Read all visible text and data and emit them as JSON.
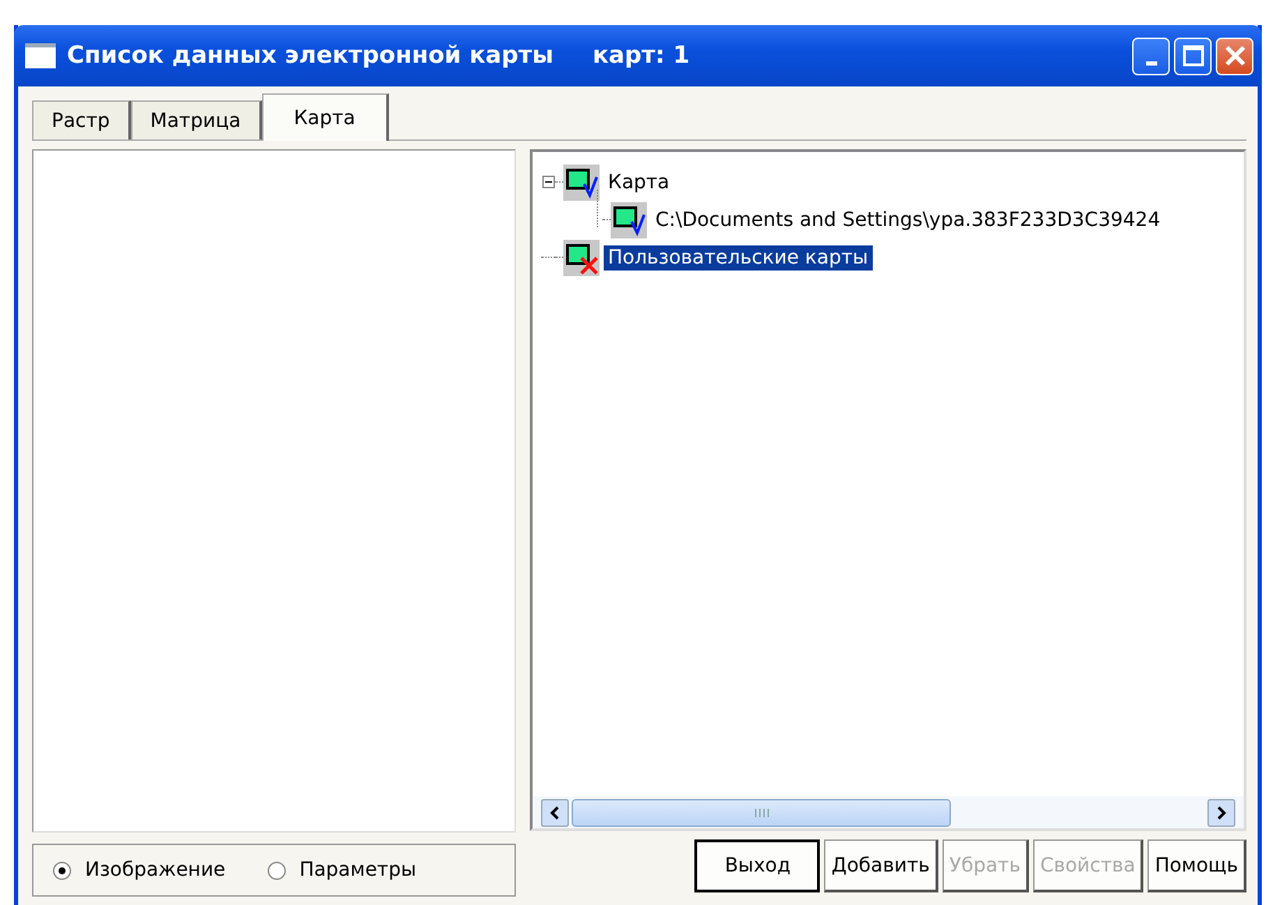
{
  "window": {
    "title": "Список данных электронной карты",
    "count": "карт: 1"
  },
  "tabs": [
    {
      "label": "Растр",
      "selected": false
    },
    {
      "label": "Матрица",
      "selected": false
    },
    {
      "label": "Карта",
      "selected": true
    }
  ],
  "tree": [
    {
      "label": "Карта",
      "kind": "map",
      "selected": false,
      "expanded": true,
      "children": [
        {
          "label": "C:\\Documents and Settings\\ура.383F233D3C39424",
          "kind": "map",
          "selected": false
        }
      ]
    },
    {
      "label": "Пользовательские карты",
      "kind": "user-map",
      "selected": true
    }
  ],
  "view_options": [
    {
      "label": "Изображение",
      "selected": true
    },
    {
      "label": "Параметры",
      "selected": false
    }
  ],
  "buttons": [
    {
      "label": "Выход",
      "disabled": false,
      "default": true
    },
    {
      "label": "Добавить",
      "disabled": false,
      "default": false
    },
    {
      "label": "Убрать",
      "disabled": true,
      "default": false
    },
    {
      "label": "Свойства",
      "disabled": true,
      "default": false
    },
    {
      "label": "Помощь",
      "disabled": false,
      "default": false
    }
  ]
}
